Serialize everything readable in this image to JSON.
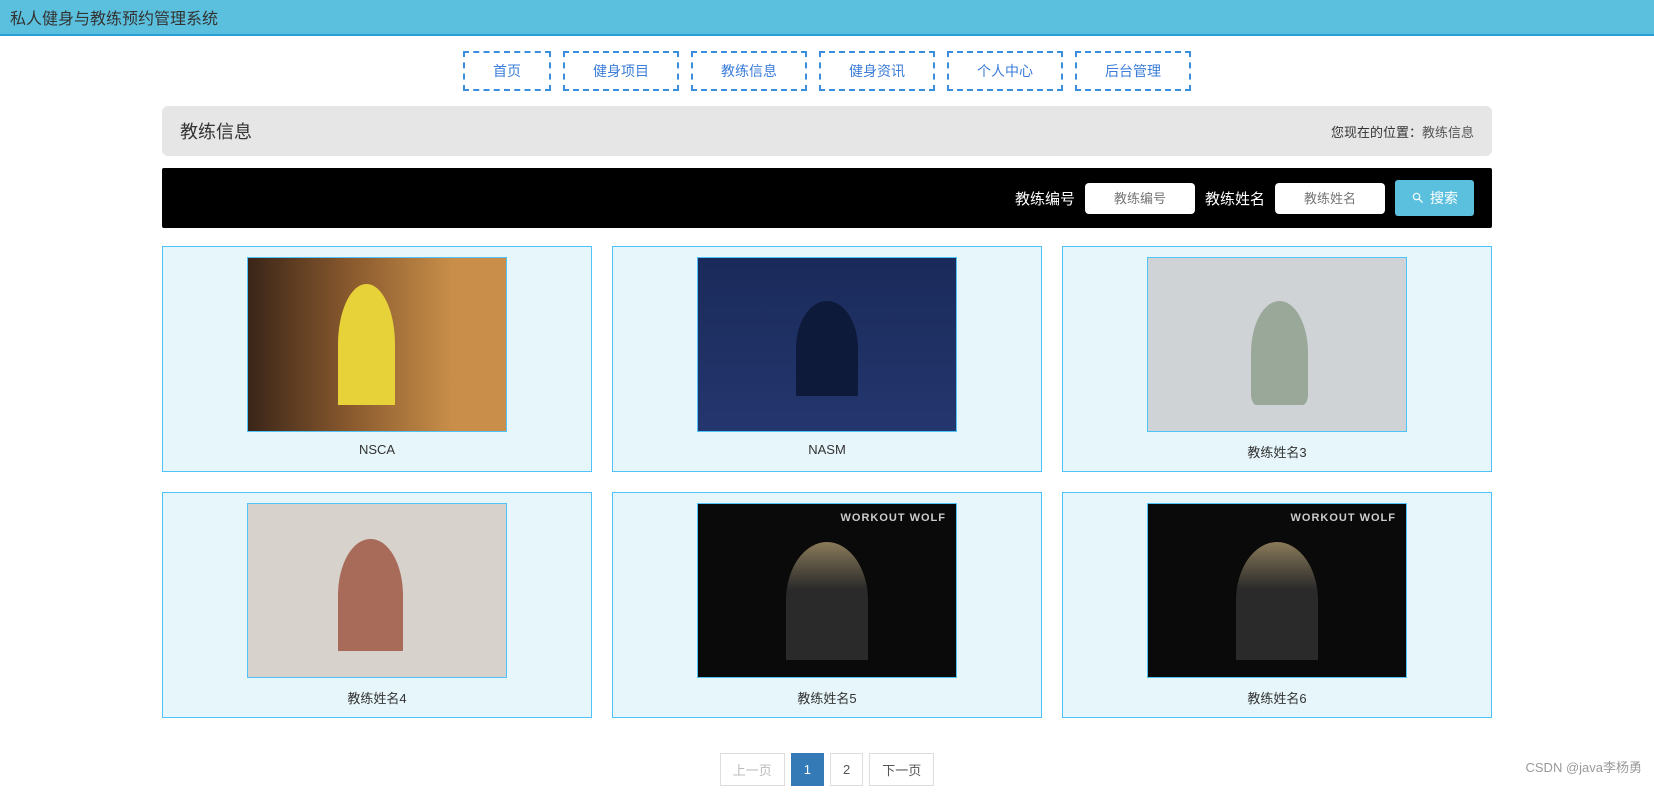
{
  "header": {
    "title": "私人健身与教练预约管理系统"
  },
  "nav": {
    "items": [
      {
        "label": "首页"
      },
      {
        "label": "健身项目"
      },
      {
        "label": "教练信息"
      },
      {
        "label": "健身资讯"
      },
      {
        "label": "个人中心"
      },
      {
        "label": "后台管理"
      }
    ]
  },
  "titlebar": {
    "title": "教练信息",
    "breadcrumb_prefix": "您现在的位置：",
    "breadcrumb_current": "教练信息"
  },
  "search": {
    "field1_label": "教练编号",
    "field1_placeholder": "教练编号",
    "field2_label": "教练姓名",
    "field2_placeholder": "教练姓名",
    "button_label": "搜索"
  },
  "coaches": [
    {
      "name": "NSCA",
      "img": "ph-gym1"
    },
    {
      "name": "NASM",
      "img": "ph-guy1"
    },
    {
      "name": "教练姓名3",
      "img": "ph-girl2"
    },
    {
      "name": "教练姓名4",
      "img": "ph-girl3"
    },
    {
      "name": "教练姓名5",
      "img": "ph-wolf"
    },
    {
      "name": "教练姓名6",
      "img": "ph-wolf"
    }
  ],
  "pagination": {
    "prev": "上一页",
    "pages": [
      "1",
      "2"
    ],
    "active": "1",
    "next": "下一页"
  },
  "watermark": "CSDN @java李杨勇"
}
